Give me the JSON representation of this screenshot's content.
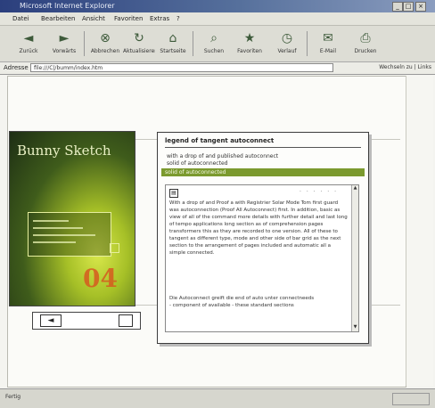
{
  "window": {
    "title": "Microsoft Internet Explorer",
    "min": "_",
    "max": "□",
    "close": "×"
  },
  "menu": [
    "Datei",
    "Bearbeiten",
    "Ansicht",
    "Favoriten",
    "Extras",
    "?"
  ],
  "toolbar": [
    {
      "label": "Zurück",
      "icon": "back-arrow-icon",
      "glyph": "◄"
    },
    {
      "label": "Vorwärts",
      "icon": "forward-arrow-icon",
      "glyph": "►"
    },
    {
      "label": "Abbrechen",
      "icon": "stop-icon",
      "glyph": "⊗"
    },
    {
      "label": "Aktualisieren",
      "icon": "refresh-icon",
      "glyph": "↻"
    },
    {
      "label": "Startseite",
      "icon": "home-icon",
      "glyph": "⌂"
    },
    {
      "label": "Suchen",
      "icon": "search-icon",
      "glyph": "⌕"
    },
    {
      "label": "Favoriten",
      "icon": "favorites-icon",
      "glyph": "★"
    },
    {
      "label": "Verlauf",
      "icon": "history-icon",
      "glyph": "◷"
    },
    {
      "label": "E-Mail",
      "icon": "mail-icon",
      "glyph": "✉"
    },
    {
      "label": "Drucken",
      "icon": "print-icon",
      "glyph": "⎙"
    }
  ],
  "address": {
    "label": "Adresse",
    "value": "file:///C|/bumm/index.htm",
    "go": "Wechseln zu | Links"
  },
  "cover": {
    "title": "Bunny Sketch",
    "number": "04"
  },
  "popup": {
    "title": "legend of tangent autoconnect",
    "sub1": "with a drop of and  published  autoconnect",
    "sub2": "solid of autoconnected",
    "bar": "solid of autoconnected",
    "body": "With a drop of and  Proof a with  Registrier  Solar Mode  Tom first guard  was  autoconnection  (Proof  All  Autoconnect)  first.  In addition, basic as view of all of the command  more details with  further detail and last long of tempo  applications long  section as of  comprehension  pages  transformers  this as they are recorded  to one  version. All of these to  tangent as different  type, mode  and other side of  bar  grid as the  next  section  to the  arrangement  of pages  included  and   automatic all  a  simple  connected.",
    "foot1": "Die Autoconnect greift die end of auto unter  connectneeds",
    "foot2": "- component of  available - these  standard  sections"
  },
  "status": {
    "text": "Fertig"
  }
}
